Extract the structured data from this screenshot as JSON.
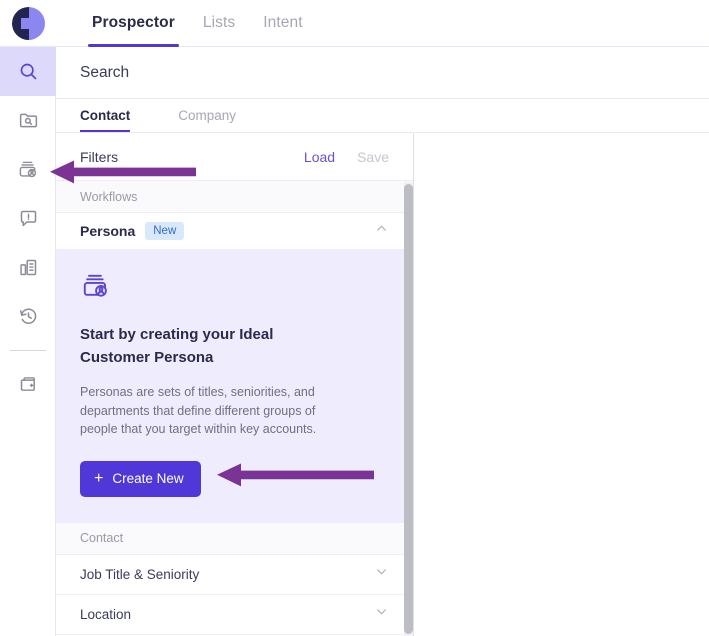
{
  "app": {
    "logo": "company-logo"
  },
  "nav": {
    "items": [
      {
        "label": "Prospector",
        "active": true
      },
      {
        "label": "Lists",
        "active": false
      },
      {
        "label": "Intent",
        "active": false
      }
    ]
  },
  "rail": {
    "items": [
      {
        "icon": "search-icon",
        "active": true
      },
      {
        "icon": "folder-search-icon",
        "active": false
      },
      {
        "icon": "persona-contacts-icon",
        "active": false
      },
      {
        "icon": "alert-message-icon",
        "active": false
      },
      {
        "icon": "buildings-icon",
        "active": false
      },
      {
        "icon": "history-clock-icon",
        "active": false
      },
      {
        "icon": "wallet-add-icon",
        "active": false
      }
    ]
  },
  "search": {
    "value": "",
    "placeholder": "Search"
  },
  "subtabs": [
    {
      "label": "Contact",
      "active": true
    },
    {
      "label": "Company",
      "active": false
    }
  ],
  "filters": {
    "title": "Filters",
    "load_label": "Load",
    "save_label": "Save",
    "workflows_label": "Workflows",
    "persona": {
      "name": "Persona",
      "badge": "New",
      "card": {
        "icon": "persona-contacts-icon",
        "title": "Start by creating your Ideal Customer Persona",
        "description": "Personas are sets of titles, seniorities, and departments that define different groups of people that you target within key accounts.",
        "button_label": "Create New",
        "button_icon": "plus-icon"
      }
    },
    "contact_label": "Contact",
    "contact_rows": [
      {
        "label": "Job Title & Seniority"
      },
      {
        "label": "Location"
      }
    ]
  },
  "annotations": [
    {
      "name": "arrow-to-persona-rail-icon",
      "direction": "left"
    },
    {
      "name": "arrow-to-create-new-button",
      "direction": "left"
    }
  ],
  "colors": {
    "accent": "#4f37d8",
    "accent_light": "#eeecfd",
    "rail_active": "#dcd9fa",
    "badge_bg": "#d9e8fb",
    "badge_text": "#2d6fc9",
    "annotation": "#7b3396",
    "text_dark": "#2b2b4a",
    "text_muted": "#9a9aa8"
  }
}
